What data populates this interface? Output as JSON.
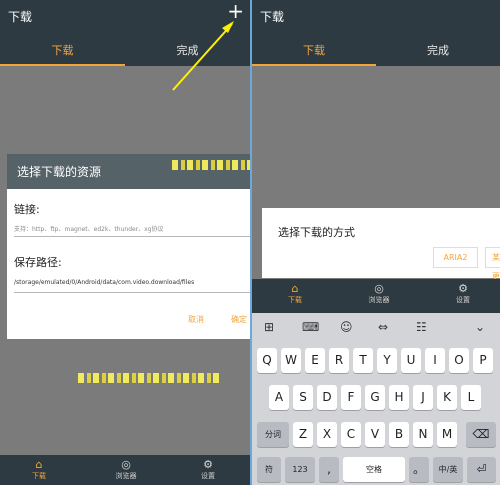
{
  "left": {
    "title": "下载",
    "plus": "+",
    "tabs": [
      "下载",
      "完成"
    ],
    "dialog": {
      "title": "选择下载的资源",
      "link_label": "链接:",
      "link_placeholder": "支持：http、ftp、magnet、ed2k、thunder、xg协议",
      "path_label": "保存路径:",
      "path_value": "/storage/emulated/0/Android/data/com.video.download/files",
      "cancel": "取消",
      "confirm": "确定"
    },
    "nav": [
      {
        "icon": "⌂",
        "label": "下载"
      },
      {
        "icon": "◎",
        "label": "浏览器"
      },
      {
        "icon": "⚙",
        "label": "设置"
      }
    ]
  },
  "right": {
    "title": "下载",
    "tabs": [
      "下载",
      "完成"
    ],
    "dialog": {
      "title": "选择下载的方式",
      "option1": "ARIA2",
      "option2": "某更"
    },
    "nav": [
      {
        "icon": "⌂",
        "label": "下载"
      },
      {
        "icon": "◎",
        "label": "浏览器"
      },
      {
        "icon": "⚙",
        "label": "设置"
      }
    ],
    "keyboard": {
      "toolbar": [
        "⊞",
        "⌨",
        "☺",
        "⇔",
        "☷",
        "⌄"
      ],
      "row1": [
        "Q",
        "W",
        "E",
        "R",
        "T",
        "Y",
        "U",
        "I",
        "O",
        "P"
      ],
      "row2": [
        "A",
        "S",
        "D",
        "F",
        "G",
        "H",
        "J",
        "K",
        "L"
      ],
      "row3": [
        "分词",
        "Z",
        "X",
        "C",
        "V",
        "B",
        "N",
        "M",
        "⌫"
      ],
      "row4": [
        "符",
        "123",
        ",",
        "空格",
        "。",
        "中/英",
        "⏎"
      ]
    }
  },
  "colors": {
    "accent": "#f2a63a",
    "appbar": "#2e3a41",
    "dialog_header": "#556268",
    "annotation": "#fff200"
  }
}
